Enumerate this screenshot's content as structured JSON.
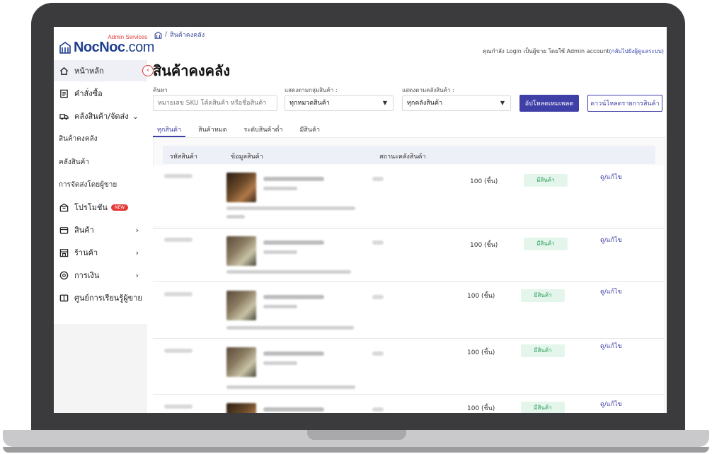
{
  "logo": {
    "brand_bold": "NocNoc",
    "brand_light": ".com",
    "tag": "Admin Services"
  },
  "sidebar": {
    "items": [
      {
        "label": "หน้าหลัก",
        "icon": "home-icon"
      },
      {
        "label": "คำสั่งซื้อ",
        "icon": "order-list-icon"
      },
      {
        "label": "คลังสินค้า/จัดส่ง",
        "icon": "truck-icon"
      },
      {
        "label": "โปรโมชัน",
        "icon": "promotion-icon",
        "badge": "NEW"
      },
      {
        "label": "สินค้า",
        "icon": "product-box-icon"
      },
      {
        "label": "ร้านค้า",
        "icon": "store-icon"
      },
      {
        "label": "การเงิน",
        "icon": "finance-icon"
      },
      {
        "label": "ศูนย์การเรียนรู้ผู้ขาย",
        "icon": "book-icon"
      }
    ],
    "sub_items": [
      "สินค้าคงคลัง",
      "คลังสินค้า",
      "การจัดส่งโดยผู้ขาย"
    ]
  },
  "breadcrumb": {
    "separator": "/",
    "current": "สินค้าคงคลัง"
  },
  "account": {
    "text": "คุณกำลัง Login เป็นผู้ขาย โดยใช้ Admin account",
    "link": "(กลับไปยังผู้ดูแลระบบ)"
  },
  "page_title": "สินค้าคงคลัง",
  "filters": {
    "search_label": "ค้นหา",
    "search_placeholder": "หมายเลข SKU โค้ดสินค้า หรือชื่อสินค้า",
    "group_label": "แสดงตามกลุ่มสินค้า :",
    "group_value": "ทุกหมวดสินค้า",
    "warehouse_label": "แสดงตามคลังสินค้า :",
    "warehouse_value": "ทุกคลังสินค้า",
    "upload_button": "อัปโหลดเทมเพลต",
    "download_button": "ดาวน์โหลดรายการสินค้า"
  },
  "tabs": [
    "ทุกสินค้า",
    "สินค้าหมด",
    "ระดับสินค้าต่ำ",
    "มีสินค้า"
  ],
  "table": {
    "headers": [
      "รหัสสินค้า",
      "ข้อมูลสินค้า",
      "สถานะคลังสินค้า"
    ],
    "rows": [
      {
        "qty": "100 (ชิ้น)",
        "status": "มีสินค้า",
        "action": "ดู/แก้ไข"
      },
      {
        "qty": "100 (ชิ้น)",
        "status": "มีสินค้า",
        "action": "ดู/แก้ไข"
      },
      {
        "qty": "100 (ชิ้น)",
        "status": "มีสินค้า",
        "action": "ดู/แก้ไข"
      },
      {
        "qty": "100 (ชิ้น)",
        "status": "มีสินค้า",
        "action": "ดู/แก้ไข"
      },
      {
        "qty": "100 (ชิ้น)",
        "status": "มีสินค้า",
        "action": "ดู/แก้ไข"
      }
    ]
  },
  "colors": {
    "primary": "#3f3fa8",
    "brand": "#1f3f8f",
    "highlight": "#e00000",
    "status_bg": "#e4f6ec",
    "status_text": "#2e9e5b"
  }
}
